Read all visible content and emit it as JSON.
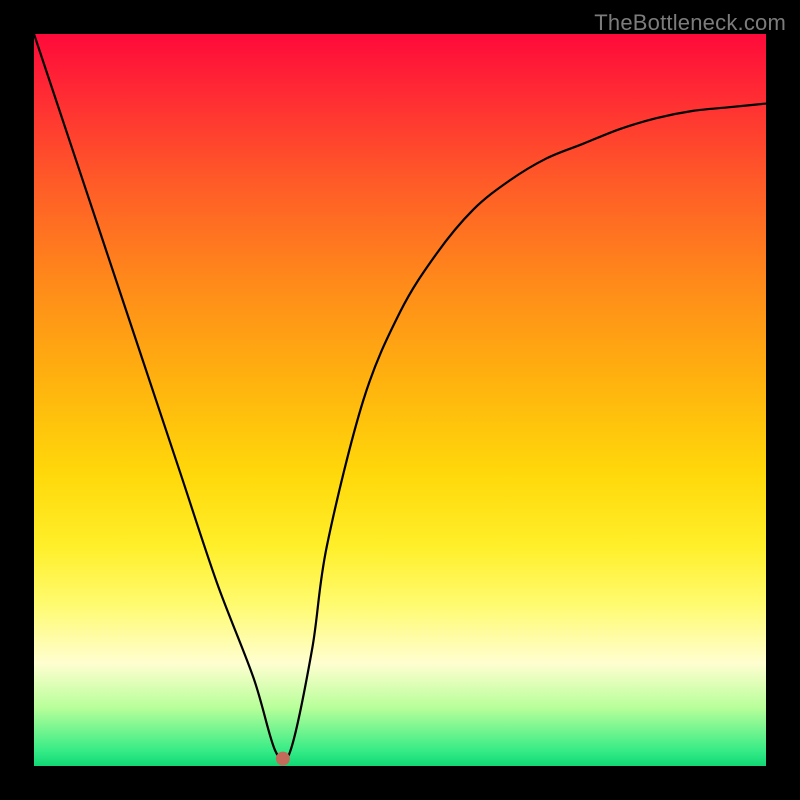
{
  "watermark": {
    "text": "TheBottleneck.com"
  },
  "chart_data": {
    "type": "line",
    "title": "",
    "xlabel": "",
    "ylabel": "",
    "xlim": [
      0,
      100
    ],
    "ylim": [
      0,
      100
    ],
    "x": [
      0,
      5,
      10,
      15,
      20,
      25,
      30,
      33,
      35,
      38,
      40,
      45,
      50,
      55,
      60,
      65,
      70,
      75,
      80,
      85,
      90,
      95,
      100
    ],
    "y": [
      100,
      85,
      70,
      55,
      40,
      25,
      12,
      2,
      2,
      16,
      30,
      50,
      62,
      70,
      76,
      80,
      83,
      85,
      87,
      88.5,
      89.5,
      90,
      90.5
    ],
    "marker": {
      "x": 34,
      "y": 1
    },
    "legend": [],
    "x_ticks": [],
    "y_ticks": [],
    "grid": false
  }
}
